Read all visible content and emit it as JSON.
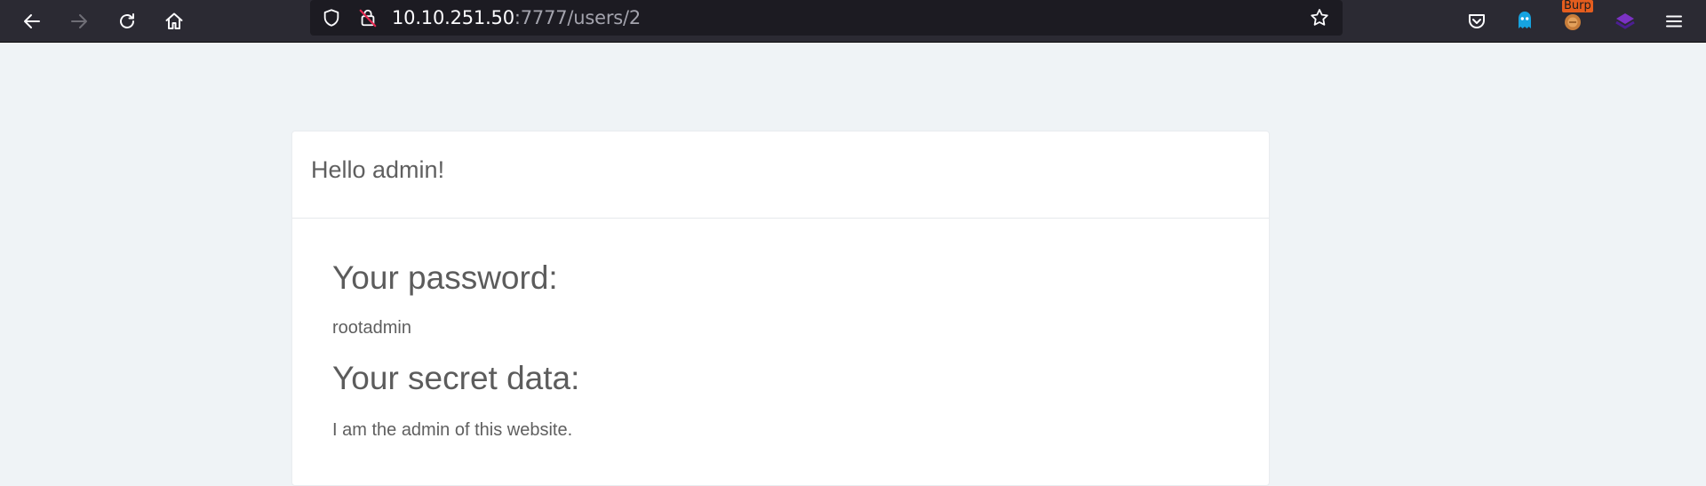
{
  "browser": {
    "url_host": "10.10.251.50",
    "url_rest": ":7777/users/2",
    "burp_badge": "Burp"
  },
  "page": {
    "greeting": "Hello admin!",
    "password_heading": "Your password:",
    "password_value": "rootadmin",
    "secret_heading": "Your secret data:",
    "secret_value": "I am the admin of this website."
  },
  "icons": {
    "back": "arrow-left-icon",
    "forward": "arrow-right-icon",
    "reload": "reload-icon",
    "home": "home-icon",
    "shield": "shield-icon",
    "insecure": "insecure-lock-icon",
    "bookmark": "star-icon",
    "pocket": "pocket-icon",
    "ghostery": "ghost-icon",
    "burp": "burp-extension-icon",
    "wappalyzer": "wappalyzer-icon",
    "menu": "hamburger-menu-icon"
  },
  "colors": {
    "toolbar": "#2b2a33",
    "urlbar": "#1c1b22",
    "page_bg": "#eff3f6",
    "card_bg": "#ffffff",
    "text": "#5f5f5f"
  }
}
